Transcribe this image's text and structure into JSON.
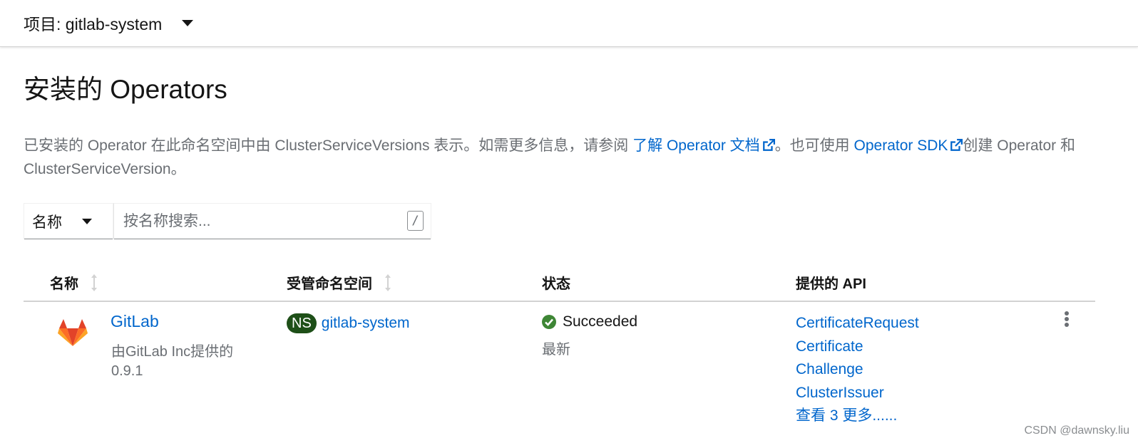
{
  "header": {
    "project_label": "项目: gitlab-system"
  },
  "page": {
    "title": "安装的 Operators",
    "description": {
      "part1": "已安装的 Operator 在此命名空间中由 ClusterServiceVersions 表示。如需更多信息，请参阅 ",
      "link1": "了解 Operator 文档",
      "part2": "。也可使用 ",
      "link2": "Operator SDK",
      "part3": "创建 Operator 和 ClusterServiceVersion。"
    }
  },
  "filter": {
    "dropdown_label": "名称",
    "placeholder": "按名称搜索...",
    "shortcut": "/"
  },
  "table": {
    "columns": {
      "name": "名称",
      "namespace": "受管命名空间",
      "status": "状态",
      "apis": "提供的 API"
    },
    "rows": [
      {
        "name": "GitLab",
        "provider": "由GitLab Inc提供的",
        "version": "0.9.1",
        "ns_badge": "NS",
        "namespace": "gitlab-system",
        "status": "Succeeded",
        "status_sub": "最新",
        "apis": [
          "CertificateRequest",
          "Certificate",
          "Challenge",
          "ClusterIssuer"
        ],
        "apis_more": "查看 3 更多......"
      }
    ]
  },
  "watermark": "CSDN @dawnsky.liu",
  "colors": {
    "link": "#0066cc",
    "success": "#3e8635",
    "ns_badge_bg": "#1e4f18",
    "gitlab_orange": "#fc6d26"
  }
}
